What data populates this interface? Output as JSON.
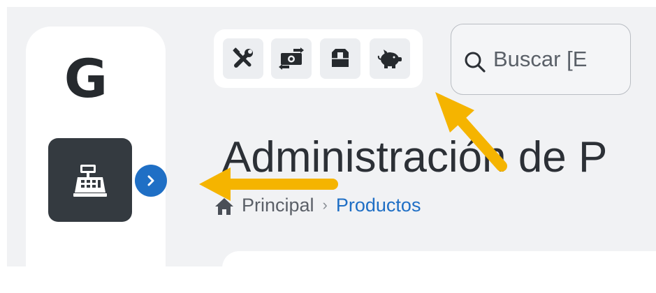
{
  "sidebar": {
    "brand": "G",
    "items": [
      {
        "icon": "cash-register-icon"
      }
    ],
    "toggle_icon": "chevron-right-icon"
  },
  "toolbar": {
    "buttons": [
      {
        "icon": "tools-icon"
      },
      {
        "icon": "money-exchange-icon"
      },
      {
        "icon": "box-icon"
      },
      {
        "icon": "piggy-bank-icon"
      }
    ]
  },
  "search": {
    "value": "",
    "placeholder": "Buscar [E"
  },
  "page": {
    "title": "Administración de P"
  },
  "breadcrumb": {
    "home_label": "Principal",
    "separator": "›",
    "current": "Productos"
  },
  "colors": {
    "accent": "#1f6fc5",
    "annotation": "#f5b400",
    "sidebar_active_bg": "#343a40",
    "page_bg": "#f1f2f4"
  }
}
